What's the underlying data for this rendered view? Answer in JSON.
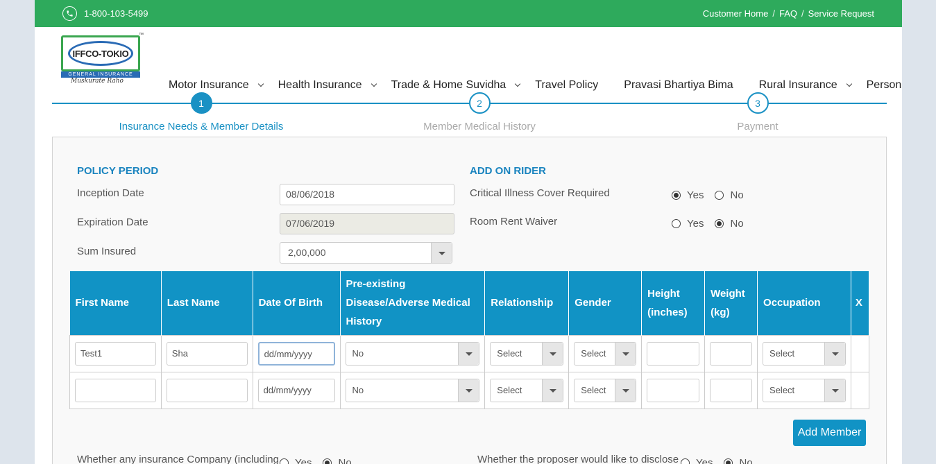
{
  "topbar": {
    "phone": "1-800-103-5499",
    "links": [
      "Customer Home",
      "FAQ",
      "Service Request"
    ],
    "separator": "/"
  },
  "logo": {
    "name": "IFFCO-TOKIO",
    "sub": "GENERAL INSURANCE",
    "tagline": "Muskurate Raho",
    "tm": "™"
  },
  "nav": {
    "items": [
      {
        "label": "Motor Insurance",
        "dropdown": true
      },
      {
        "label": "Health Insurance",
        "dropdown": true
      },
      {
        "label": "Trade & Home Suvidha",
        "dropdown": true
      },
      {
        "label": "Travel Policy",
        "dropdown": false
      },
      {
        "label": "Pravasi Bhartiya Bima",
        "dropdown": false
      },
      {
        "label": "Rural Insurance",
        "dropdown": true
      },
      {
        "label": "Personal Accident Policy",
        "dropdown": true
      }
    ]
  },
  "stepper": {
    "steps": [
      {
        "num": "1",
        "label": "Insurance Needs & Member Details",
        "active": true
      },
      {
        "num": "2",
        "label": "Member Medical History",
        "active": false
      },
      {
        "num": "3",
        "label": "Payment",
        "active": false
      }
    ]
  },
  "policy": {
    "title": "POLICY PERIOD",
    "inception_label": "Inception Date",
    "inception_value": "08/06/2018",
    "expiration_label": "Expiration Date",
    "expiration_value": "07/06/2019",
    "sum_label": "Sum Insured",
    "sum_value": "2,00,000"
  },
  "rider": {
    "title": "ADD ON RIDER",
    "critical_label": "Critical Illness Cover Required",
    "critical_value": "Yes",
    "room_label": "Room Rent Waiver",
    "room_value": "No",
    "yes": "Yes",
    "no": "No"
  },
  "table": {
    "headers": [
      "First Name",
      "Last Name",
      "Date Of Birth",
      "Pre-existing Disease/Adverse Medical History",
      "Relationship",
      "Gender",
      "Height (inches)",
      "Weight (kg)",
      "Occupation",
      "X"
    ],
    "rows": [
      {
        "first": "Test1",
        "last": "Sha",
        "dob": "dd/mm/yyyy",
        "disease": "No",
        "relationship": "Select",
        "gender": "Select",
        "height": "",
        "weight": "",
        "occupation": "Select"
      },
      {
        "first": "",
        "last": "",
        "dob": "dd/mm/yyyy",
        "disease": "No",
        "relationship": "Select",
        "gender": "Select",
        "height": "",
        "weight": "",
        "occupation": "Select"
      }
    ]
  },
  "add_member": "Add Member",
  "bottom": {
    "q1": "Whether any insurance Company (including",
    "q2": "Whether the proposer would like to disclose",
    "yes": "Yes",
    "no": "No"
  },
  "colors": {
    "green": "#2eaa5c",
    "blue": "#1193c5",
    "accent": "#1a84bf"
  }
}
